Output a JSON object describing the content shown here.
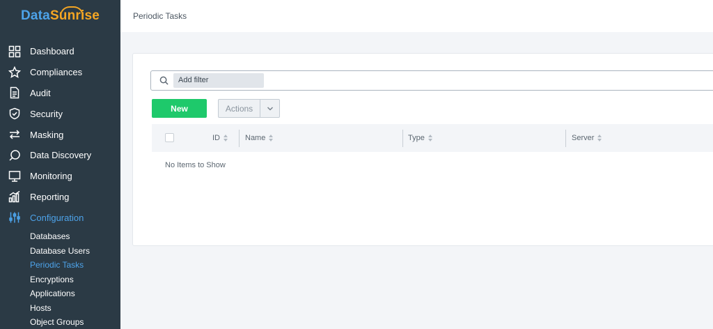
{
  "brand": {
    "part1": "Data",
    "part2": "Sunrise"
  },
  "sidebar": {
    "items": [
      {
        "label": "Dashboard",
        "icon": "dashboard-icon"
      },
      {
        "label": "Compliances",
        "icon": "star-icon"
      },
      {
        "label": "Audit",
        "icon": "document-icon"
      },
      {
        "label": "Security",
        "icon": "shield-icon"
      },
      {
        "label": "Masking",
        "icon": "arrows-icon"
      },
      {
        "label": "Data Discovery",
        "icon": "chat-search-icon"
      },
      {
        "label": "Monitoring",
        "icon": "monitor-icon"
      },
      {
        "label": "Reporting",
        "icon": "bar-chart-icon"
      },
      {
        "label": "Configuration",
        "icon": "sliders-icon",
        "active": true
      }
    ],
    "subitems": [
      "Databases",
      "Database Users",
      "Periodic Tasks",
      "Encryptions",
      "Applications",
      "Hosts",
      "Object Groups"
    ],
    "active_subitem": "Periodic Tasks"
  },
  "header": {
    "title": "Periodic Tasks"
  },
  "filter": {
    "chip_label": "Add filter"
  },
  "toolbar": {
    "new_label": "New",
    "actions_label": "Actions"
  },
  "table": {
    "columns": [
      "ID",
      "Name",
      "Type",
      "Server"
    ],
    "empty_text": "No Items to Show"
  },
  "colors": {
    "sidebar_bg": "#2b3a45",
    "accent": "#4da3ea",
    "new_button": "#1ec96b",
    "brand_orange": "#f5a623"
  }
}
